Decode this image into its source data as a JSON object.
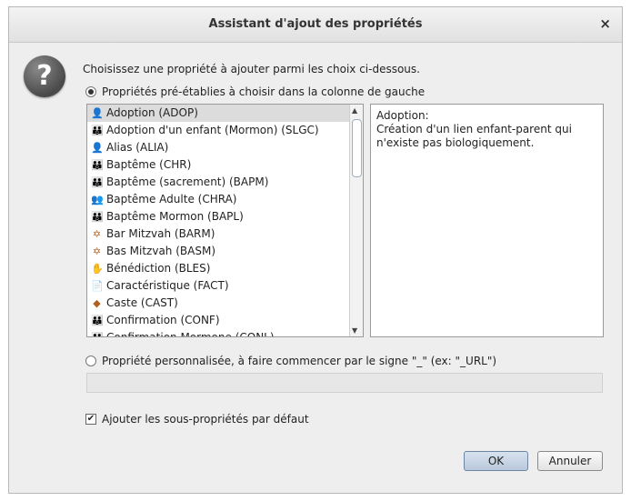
{
  "dialog": {
    "title": "Assistant d'ajout des propriétés",
    "close_label": "×",
    "question_glyph": "?",
    "prompt": "Choisissez une propriété à ajouter parmi les choix ci-dessous.",
    "predefined_option": "Propriétés pré-établies à choisir dans la colonne de gauche",
    "custom_option": "Propriété personnalisée, à faire commencer par le signe \"_\" (ex: \"_URL\")",
    "custom_value": "",
    "subprops_label": "Ajouter les sous-propriétés par défaut",
    "subprops_checked": true,
    "ok_label": "OK",
    "cancel_label": "Annuler"
  },
  "list": {
    "selected_index": 0,
    "items": [
      {
        "label": "Adoption (ADOP)",
        "icon": "adoption-icon",
        "glyph": "👤"
      },
      {
        "label": "Adoption d'un enfant (Mormon) (SLGC)",
        "icon": "family-icon",
        "glyph": "👪"
      },
      {
        "label": "Alias (ALIA)",
        "icon": "person-icon",
        "glyph": "👤"
      },
      {
        "label": "Baptême (CHR)",
        "icon": "family-icon",
        "glyph": "👪"
      },
      {
        "label": "Baptême (sacrement) (BAPM)",
        "icon": "family-icon",
        "glyph": "👪"
      },
      {
        "label": "Baptême Adulte (CHRA)",
        "icon": "adult-icon",
        "glyph": "👥"
      },
      {
        "label": "Baptême Mormon (BAPL)",
        "icon": "family-icon",
        "glyph": "👪"
      },
      {
        "label": "Bar Mitzvah (BARM)",
        "icon": "star-of-david-icon",
        "glyph": "✡"
      },
      {
        "label": "Bas Mitzvah (BASM)",
        "icon": "star-of-david-icon",
        "glyph": "✡"
      },
      {
        "label": "Bénédiction (BLES)",
        "icon": "hand-icon",
        "glyph": "✋"
      },
      {
        "label": "Caractéristique (FACT)",
        "icon": "document-icon",
        "glyph": "📄"
      },
      {
        "label": "Caste (CAST)",
        "icon": "diamond-icon",
        "glyph": "◆"
      },
      {
        "label": "Confirmation (CONF)",
        "icon": "family-icon",
        "glyph": "👪"
      },
      {
        "label": "Confirmation Mormone (CONL)",
        "icon": "family-icon",
        "glyph": "👪"
      }
    ]
  },
  "description": "Adoption:\nCréation d'un lien enfant-parent qui\nn'existe pas biologiquement.",
  "colors": {
    "dialog_bg": "#eeeeee",
    "selected_row": "#dcdcdc",
    "ok_button": "#c3d2e2"
  }
}
